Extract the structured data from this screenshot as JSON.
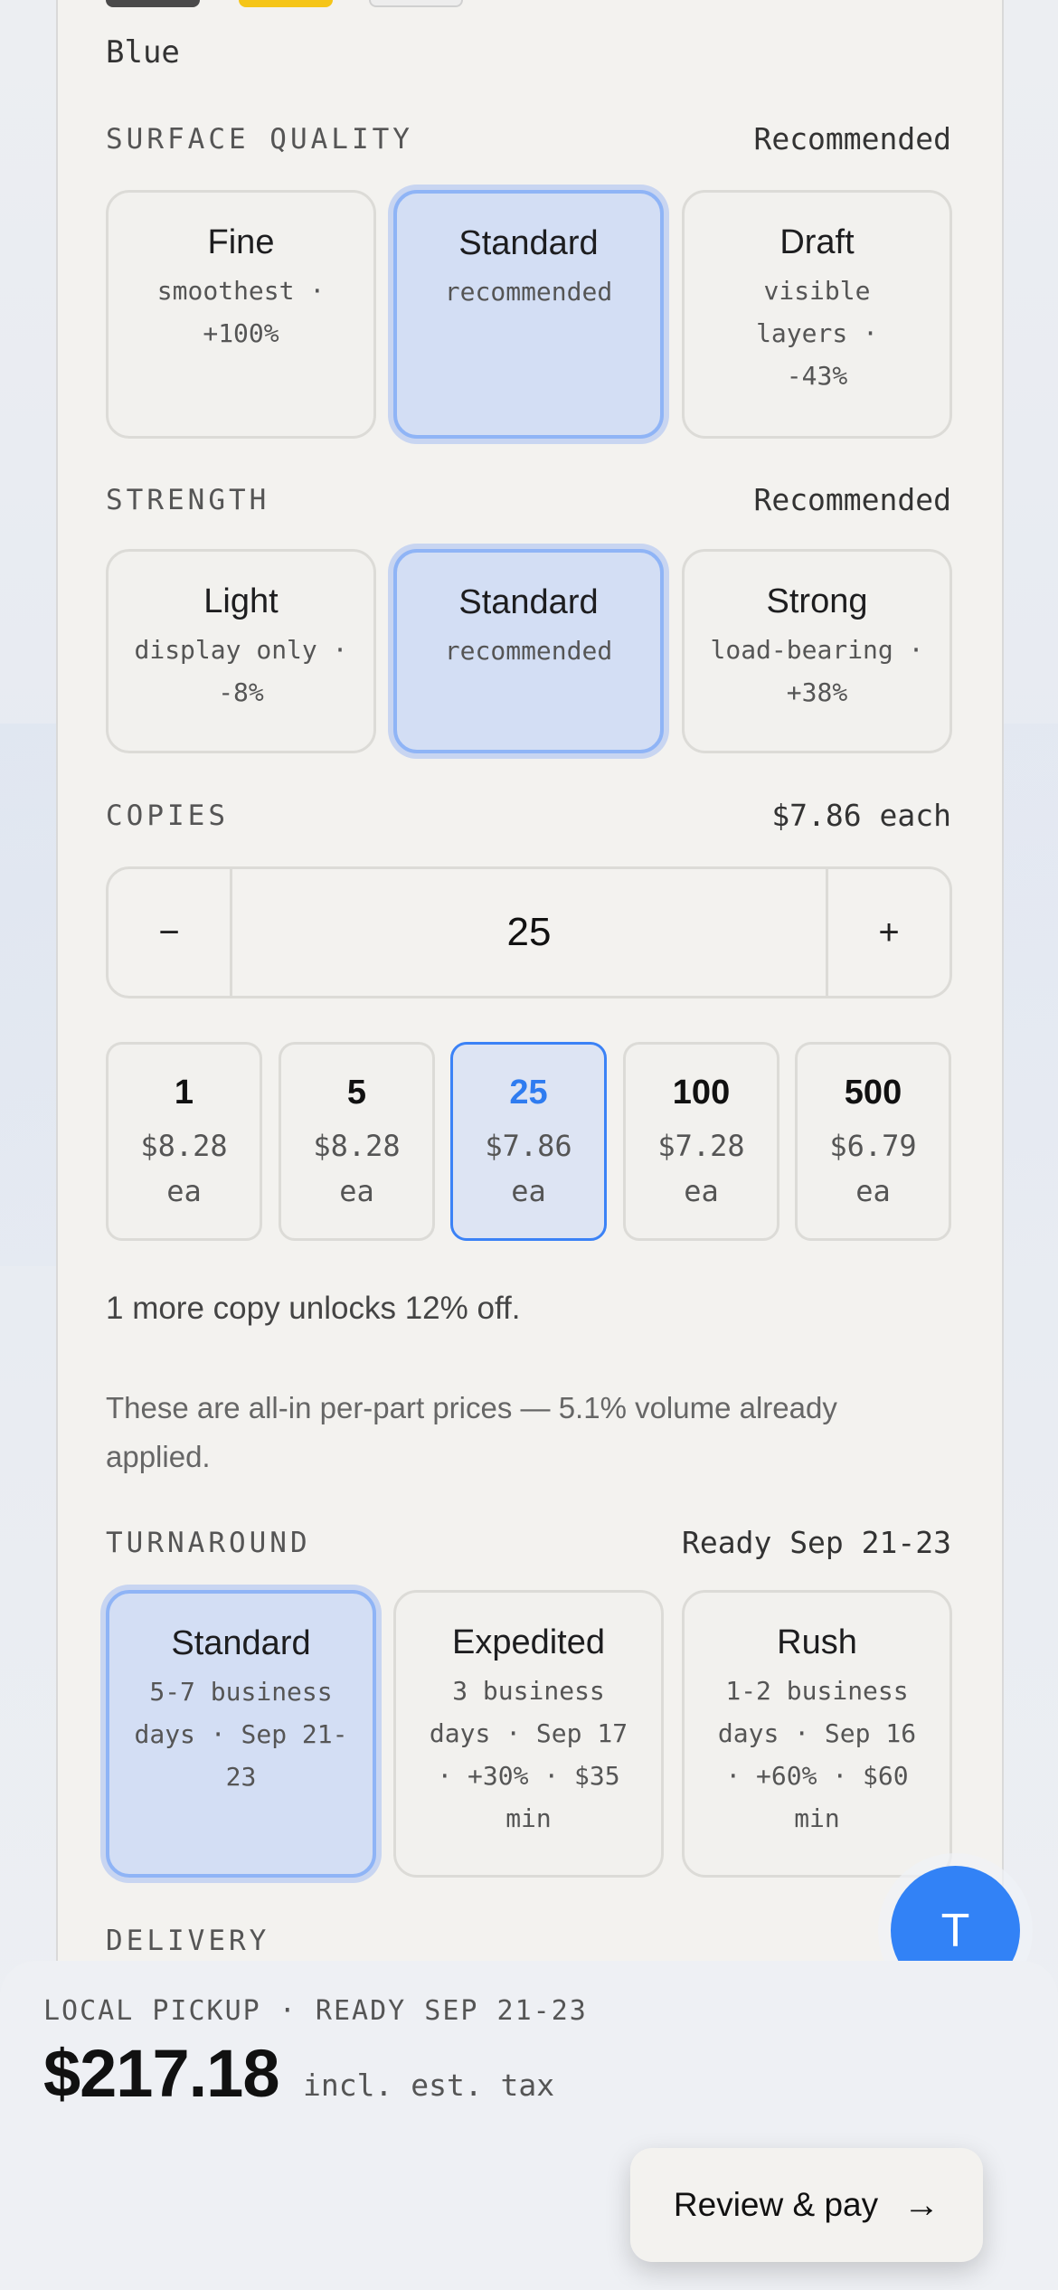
{
  "color": {
    "current": "Blue",
    "swatches": [
      "#4a4a4a",
      "#f5c518",
      "#ededed"
    ]
  },
  "surface_quality": {
    "label": "SURFACE QUALITY",
    "note": "Recommended",
    "options": [
      {
        "title": "Fine",
        "sub": "smoothest · +100%"
      },
      {
        "title": "Standard",
        "sub": "recommended",
        "selected": true
      },
      {
        "title": "Draft",
        "sub": "visible layers · -43%"
      }
    ]
  },
  "strength": {
    "label": "STRENGTH",
    "note": "Recommended",
    "options": [
      {
        "title": "Light",
        "sub": "display only · -8%"
      },
      {
        "title": "Standard",
        "sub": "recommended",
        "selected": true
      },
      {
        "title": "Strong",
        "sub": "load-bearing · +38%"
      }
    ]
  },
  "copies": {
    "label": "COPIES",
    "each_price": "$7.86 each",
    "minus": "−",
    "plus": "+",
    "value": "25",
    "tiers": [
      {
        "qty": "1",
        "price": "$8.28",
        "unit": "ea"
      },
      {
        "qty": "5",
        "price": "$8.28",
        "unit": "ea"
      },
      {
        "qty": "25",
        "price": "$7.86",
        "unit": "ea",
        "selected": true
      },
      {
        "qty": "100",
        "price": "$7.28",
        "unit": "ea"
      },
      {
        "qty": "500",
        "price": "$6.79",
        "unit": "ea"
      }
    ],
    "unlock_note": "1 more copy unlocks 12% off.",
    "price_note": "These are all-in per-part prices — 5.1% volume already applied."
  },
  "turnaround": {
    "label": "TURNAROUND",
    "note": "Ready Sep 21-23",
    "options": [
      {
        "title": "Standard",
        "sub": "5-7 business days · Sep 21-23",
        "selected": true
      },
      {
        "title": "Expedited",
        "sub": "3 business days · Sep 17 · +30% · $35 min"
      },
      {
        "title": "Rush",
        "sub": "1-2 business days · Sep 16 · +60% · $60 min"
      }
    ]
  },
  "delivery": {
    "label": "DELIVERY"
  },
  "fab": {
    "initial": "T"
  },
  "footer": {
    "pickup": "LOCAL PICKUP · READY SEP 21-23",
    "total": "$217.18",
    "tax_note": "incl. est. tax",
    "pay_label": "Review & pay",
    "pay_arrow": "→"
  }
}
